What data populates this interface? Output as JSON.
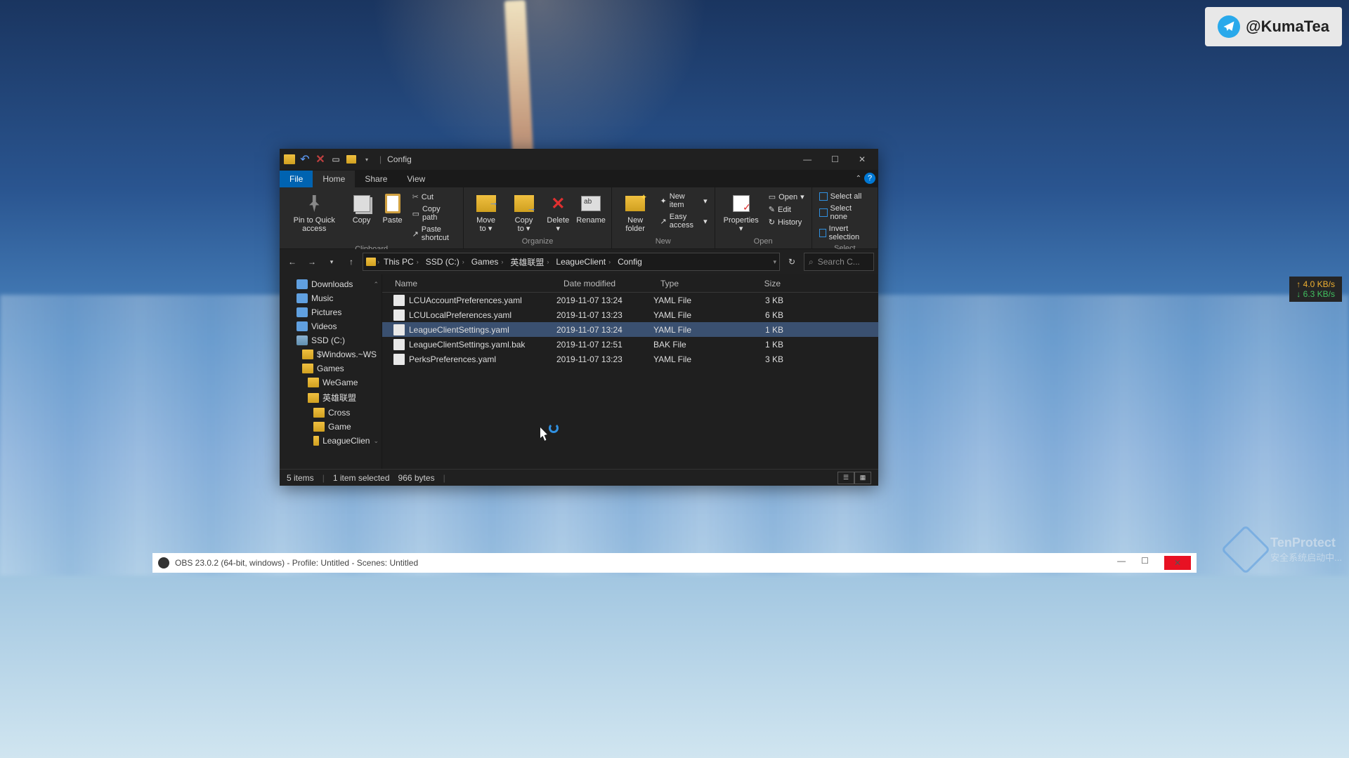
{
  "watermark": {
    "handle": "@KumaTea"
  },
  "net": {
    "up": "4.0 KB/s",
    "down": "6.3 KB/s"
  },
  "tenprotect": {
    "title": "TenProtect",
    "subtitle": "安全系统启动中..."
  },
  "taskbar": {
    "obs": "OBS 23.0.2 (64-bit, windows) - Profile: Untitled - Scenes: Untitled"
  },
  "window": {
    "title": "Config",
    "tabs": {
      "file": "File",
      "home": "Home",
      "share": "Share",
      "view": "View"
    },
    "ribbon": {
      "clipboard": {
        "label": "Clipboard",
        "pin": "Pin to Quick access",
        "copy": "Copy",
        "paste": "Paste",
        "cut": "Cut",
        "copy_path": "Copy path",
        "paste_shortcut": "Paste shortcut"
      },
      "organize": {
        "label": "Organize",
        "move": "Move to",
        "copy": "Copy to",
        "delete": "Delete",
        "rename": "Rename"
      },
      "new": {
        "label": "New",
        "folder": "New folder",
        "item": "New item",
        "easy": "Easy access"
      },
      "open": {
        "label": "Open",
        "properties": "Properties",
        "open": "Open",
        "edit": "Edit",
        "history": "History"
      },
      "select": {
        "label": "Select",
        "all": "Select all",
        "none": "Select none",
        "invert": "Invert selection"
      }
    },
    "breadcrumb": [
      "This PC",
      "SSD (C:)",
      "Games",
      "英雄联盟",
      "LeagueClient",
      "Config"
    ],
    "search_placeholder": "Search C...",
    "sidebar": {
      "downloads": "Downloads",
      "music": "Music",
      "pictures": "Pictures",
      "videos": "Videos",
      "ssd": "SSD (C:)",
      "windows": "$Windows.~WS",
      "games": "Games",
      "wegame": "WeGame",
      "lol": "英雄联盟",
      "cross": "Cross",
      "game": "Game",
      "leagueclient": "LeagueClien"
    },
    "columns": {
      "name": "Name",
      "date": "Date modified",
      "type": "Type",
      "size": "Size"
    },
    "files": [
      {
        "name": "LCUAccountPreferences.yaml",
        "date": "2019-11-07 13:24",
        "type": "YAML File",
        "size": "3 KB",
        "selected": false
      },
      {
        "name": "LCULocalPreferences.yaml",
        "date": "2019-11-07 13:23",
        "type": "YAML File",
        "size": "6 KB",
        "selected": false
      },
      {
        "name": "LeagueClientSettings.yaml",
        "date": "2019-11-07 13:24",
        "type": "YAML File",
        "size": "1 KB",
        "selected": true
      },
      {
        "name": "LeagueClientSettings.yaml.bak",
        "date": "2019-11-07 12:51",
        "type": "BAK File",
        "size": "1 KB",
        "selected": false
      },
      {
        "name": "PerksPreferences.yaml",
        "date": "2019-11-07 13:23",
        "type": "YAML File",
        "size": "3 KB",
        "selected": false
      }
    ],
    "status": {
      "items": "5 items",
      "selected": "1 item selected",
      "bytes": "966 bytes"
    }
  }
}
